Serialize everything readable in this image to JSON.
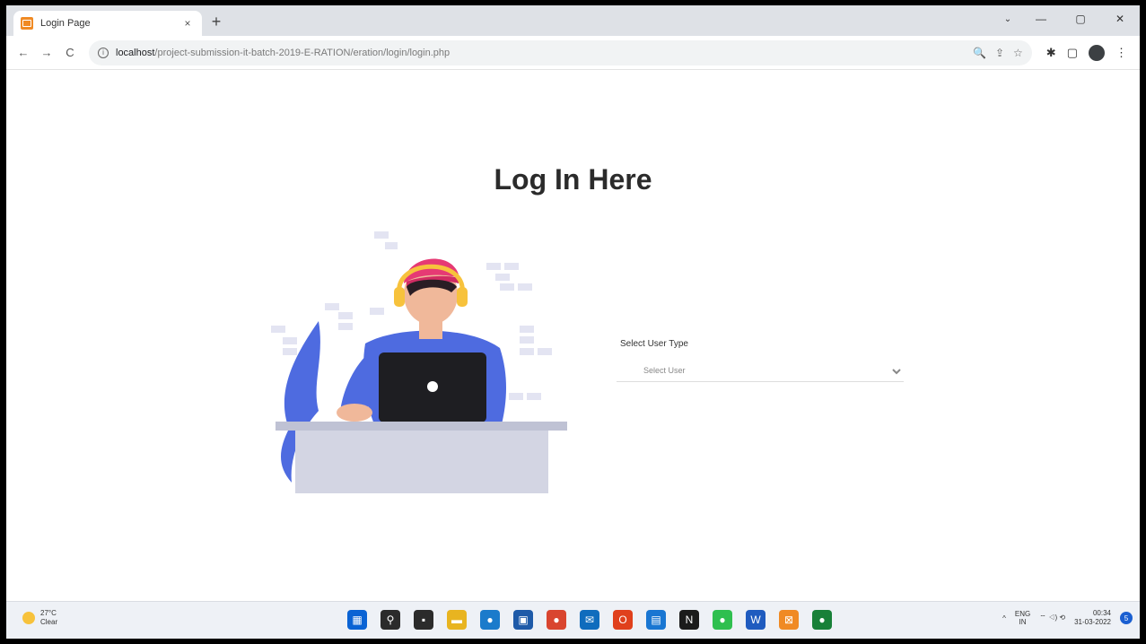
{
  "browser": {
    "tab_title": "Login Page",
    "tab_close": "×",
    "new_tab": "+",
    "window_controls": {
      "tab_search": "⌄",
      "minimize": "—",
      "maximize": "▢",
      "close": "✕"
    },
    "nav": {
      "back": "←",
      "forward": "→",
      "reload": "C"
    },
    "url_host": "localhost",
    "url_path": "/project-submission-it-batch-2019-E-RATION/eration/login/login.php",
    "omnibox_icons": {
      "zoom": "🔍",
      "share": "⇪",
      "bookmark": "☆"
    },
    "extension_icons": {
      "puzzle": "✱",
      "sidepanel": "▢"
    }
  },
  "page": {
    "title": "Log In Here",
    "form": {
      "label": "Select User Type",
      "select_value": "Select User"
    }
  },
  "taskbar": {
    "weather_temp": "27°C",
    "weather_desc": "Clear",
    "apps": [
      {
        "name": "start",
        "glyph": "▦",
        "color": "#0a63d4"
      },
      {
        "name": "search",
        "glyph": "⚲",
        "color": "#2b2b2b"
      },
      {
        "name": "task-view",
        "glyph": "▪",
        "color": "#2b2b2b"
      },
      {
        "name": "file-explorer",
        "glyph": "▬",
        "color": "#e8b420"
      },
      {
        "name": "edge",
        "glyph": "●",
        "color": "#1b7bcb"
      },
      {
        "name": "store",
        "glyph": "▣",
        "color": "#1e5aa8"
      },
      {
        "name": "chrome",
        "glyph": "●",
        "color": "#d9452f"
      },
      {
        "name": "mail",
        "glyph": "✉",
        "color": "#0f6cbd"
      },
      {
        "name": "office",
        "glyph": "O",
        "color": "#e0401c"
      },
      {
        "name": "photos",
        "glyph": "▤",
        "color": "#1976d2"
      },
      {
        "name": "netflix",
        "glyph": "N",
        "color": "#1b1b1b"
      },
      {
        "name": "whatsapp",
        "glyph": "●",
        "color": "#2fbf4f"
      },
      {
        "name": "word",
        "glyph": "W",
        "color": "#1f5bbf"
      },
      {
        "name": "xampp",
        "glyph": "⊠",
        "color": "#f08a24"
      },
      {
        "name": "chrome-active",
        "glyph": "●",
        "color": "#188038"
      }
    ],
    "tray_chevron": "^",
    "lang_top": "ENG",
    "lang_bottom": "IN",
    "tray_icons": "⌔ ◁) ⟲",
    "time": "00:34",
    "date": "31-03-2022",
    "notif_count": "5"
  }
}
